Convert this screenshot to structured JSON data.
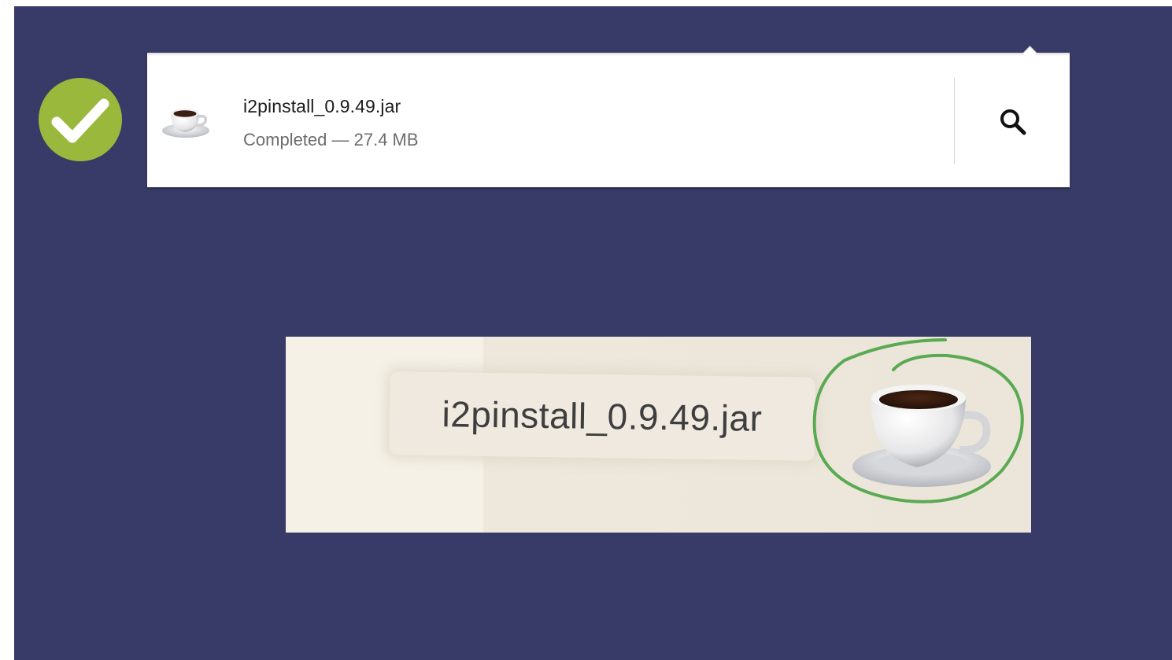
{
  "download": {
    "file_name": "i2pinstall_0.9.49.jar",
    "status": "Completed — 27.4 MB",
    "file_icon": "java-coffee-cup-icon",
    "action_icon": "magnifier-icon"
  },
  "badge": {
    "icon": "checkmark-icon",
    "color": "#9ab93c"
  },
  "zoom": {
    "label": "i2pinstall_0.9.49.jar",
    "highlight_color": "#5aaa52"
  },
  "colors": {
    "background": "#383a67",
    "panel": "#ffffff"
  }
}
